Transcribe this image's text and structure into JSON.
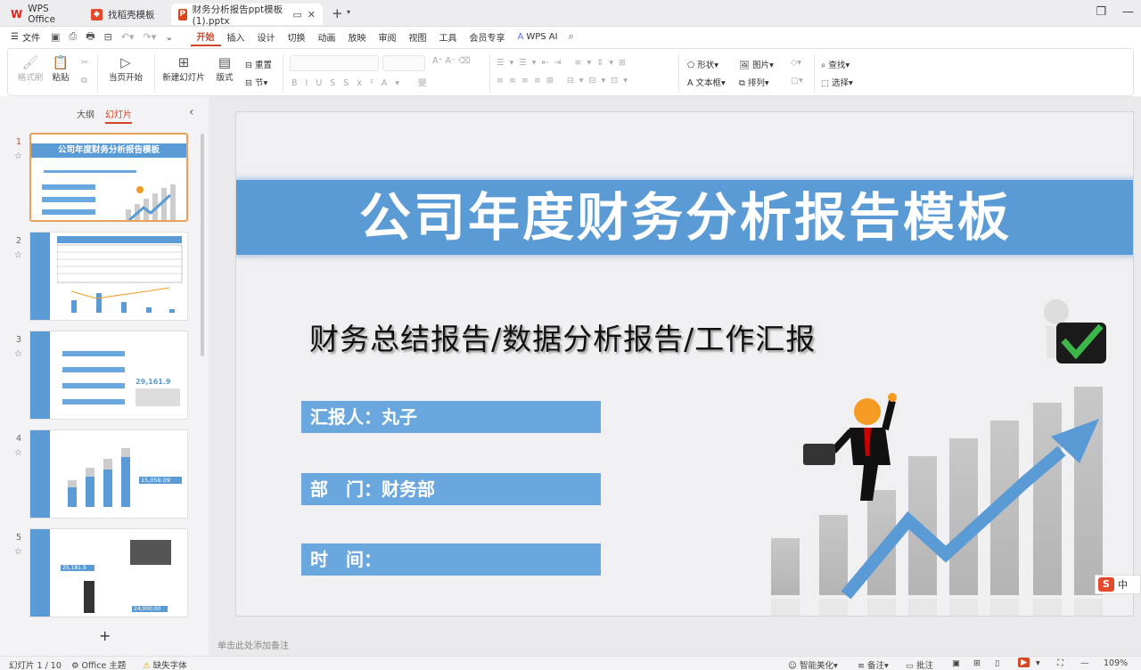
{
  "tabs": [
    {
      "label": "WPS Office"
    },
    {
      "label": "找稻壳模板"
    },
    {
      "label": "财务分析报告ppt模板(1).pptx"
    }
  ],
  "menu": {
    "file": "文件",
    "items": [
      "开始",
      "插入",
      "设计",
      "切换",
      "动画",
      "放映",
      "审阅",
      "视图",
      "工具",
      "会员专享"
    ],
    "wps_ai": "WPS AI"
  },
  "ribbon": {
    "format_painter": "格式刷",
    "paste": "粘贴",
    "from_current": "当页开始",
    "new_slide": "新建幻灯片",
    "layout": "版式",
    "reset": "重置",
    "section": "节",
    "shape": "形状",
    "picture": "图片",
    "textbox": "文本框",
    "arrange": "排列",
    "find": "查找",
    "select": "选择"
  },
  "left_pane": {
    "tab_outline": "大纲",
    "tab_slides": "幻灯片",
    "slides": [
      {
        "num": "1",
        "title": "公司年度财务分析报告模板"
      },
      {
        "num": "2",
        "title": ""
      },
      {
        "num": "3",
        "title": "",
        "value": "29,161.9"
      },
      {
        "num": "4",
        "title": "",
        "value": "15,056.09"
      },
      {
        "num": "5",
        "title": "",
        "value": "25,181.9",
        "value2": "24,000.00"
      }
    ]
  },
  "slide": {
    "title": "公司年度财务分析报告模板",
    "subtitle": "财务总结报告/数据分析报告/工作汇报",
    "reporter": "汇报人：丸子",
    "department": "部　门：财务部",
    "time": "时　间："
  },
  "notes_placeholder": "单击此处添加备注",
  "status": {
    "slide_count": "幻灯片 1 / 10",
    "theme": "Office 主题",
    "missing_font": "缺失字体",
    "beautify": "智能美化",
    "notes": "备注",
    "comments": "批注",
    "zoom": "109%"
  },
  "ime": {
    "label": "中"
  },
  "colors": {
    "accent": "#d24726",
    "slide_blue": "#5b9bd5",
    "info_blue": "#6aa7df"
  }
}
